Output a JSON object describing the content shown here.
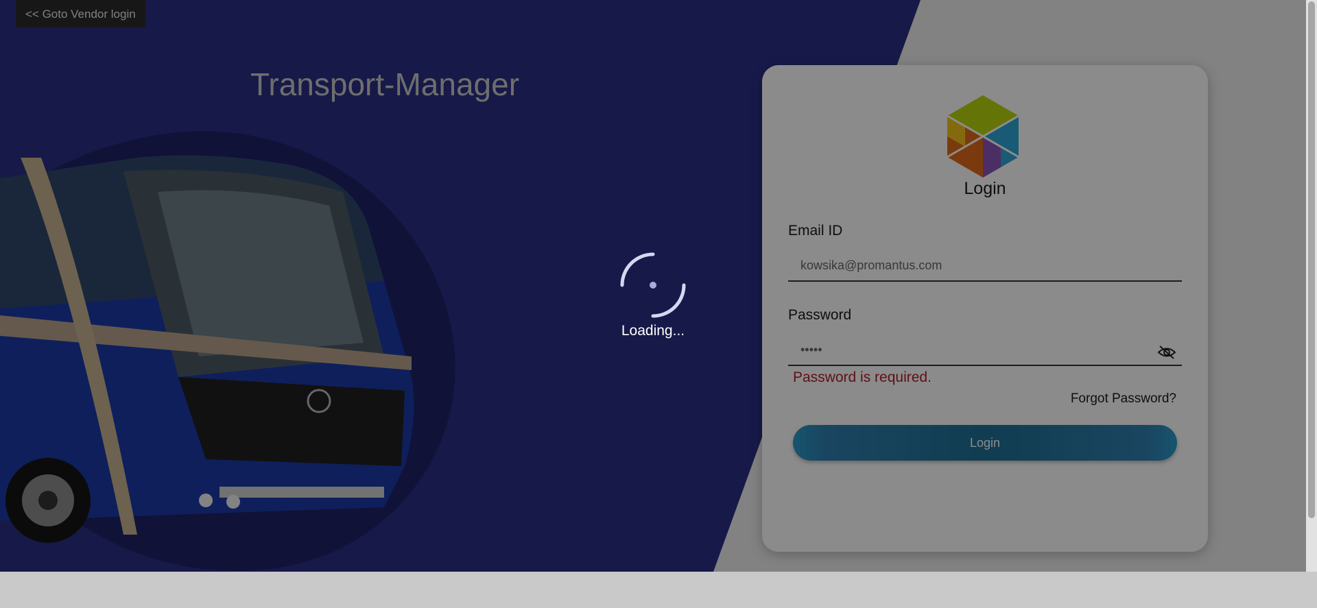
{
  "nav": {
    "goto_vendor_label": "<< Goto Vendor login"
  },
  "app": {
    "title": "Transport-Manager"
  },
  "login_card": {
    "heading": "Login",
    "email": {
      "label": "Email ID",
      "value": "kowsika@promantus.com"
    },
    "password": {
      "label": "Password",
      "value": "•••••",
      "error": "Password is required."
    },
    "forgot_label": "Forgot Password?",
    "submit_label": "Login"
  },
  "loading": {
    "text": "Loading..."
  },
  "icons": {
    "logo": "hexagon-cube-logo-icon",
    "password_toggle": "eye-off-icon",
    "spinner": "spinner-icon"
  },
  "colors": {
    "left_panel": "#2a2f86",
    "accent_button": "#1f6f94",
    "error": "#b01c2a"
  }
}
